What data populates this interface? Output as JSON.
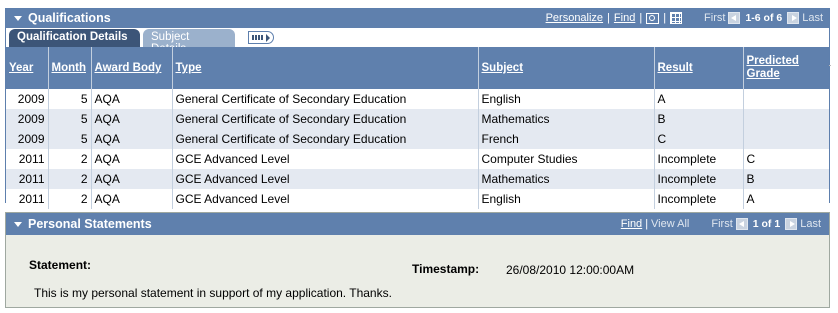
{
  "qualifications": {
    "title": "Qualifications",
    "tools": {
      "personalize": "Personalize",
      "find": "Find",
      "first": "First",
      "counter": "1-6 of 6",
      "last": "Last"
    },
    "tabs": [
      {
        "label": "Qualification Details",
        "active": true
      },
      {
        "label": "Subject Details",
        "active": false
      }
    ],
    "columns": [
      "Year",
      "Month",
      "Award Body",
      "Type",
      "Subject",
      "Result",
      "Predicted Grade"
    ],
    "rows": [
      {
        "year": "2009",
        "month": "5",
        "award_body": "AQA",
        "type": "General Certificate of Secondary Education",
        "subject": "English",
        "result": "A",
        "predicted": ""
      },
      {
        "year": "2009",
        "month": "5",
        "award_body": "AQA",
        "type": "General Certificate of Secondary Education",
        "subject": "Mathematics",
        "result": "B",
        "predicted": ""
      },
      {
        "year": "2009",
        "month": "5",
        "award_body": "AQA",
        "type": "General Certificate of Secondary Education",
        "subject": "French",
        "result": "C",
        "predicted": ""
      },
      {
        "year": "2011",
        "month": "2",
        "award_body": "AQA",
        "type": "GCE Advanced Level",
        "subject": "Computer Studies",
        "result": "Incomplete",
        "predicted": "C"
      },
      {
        "year": "2011",
        "month": "2",
        "award_body": "AQA",
        "type": "GCE Advanced Level",
        "subject": "Mathematics",
        "result": "Incomplete",
        "predicted": "B"
      },
      {
        "year": "2011",
        "month": "2",
        "award_body": "AQA",
        "type": "GCE Advanced Level",
        "subject": "English",
        "result": "Incomplete",
        "predicted": "A"
      }
    ]
  },
  "personal_statements": {
    "title": "Personal Statements",
    "tools": {
      "find": "Find",
      "view_all": "View All",
      "first": "First",
      "counter": "1 of 1",
      "last": "Last"
    },
    "statement_label": "Statement:",
    "timestamp_label": "Timestamp:",
    "timestamp_value": "26/08/2010 12:00:00AM",
    "statement_text": "This is my personal statement in support of my application. Thanks."
  },
  "colors": {
    "header_blue": "#5f80ad",
    "active_tab": "#3c5578",
    "inactive_tab": "#9bb1cc",
    "alt_row": "#e4e9f1",
    "panel_bg": "#ebede6"
  }
}
